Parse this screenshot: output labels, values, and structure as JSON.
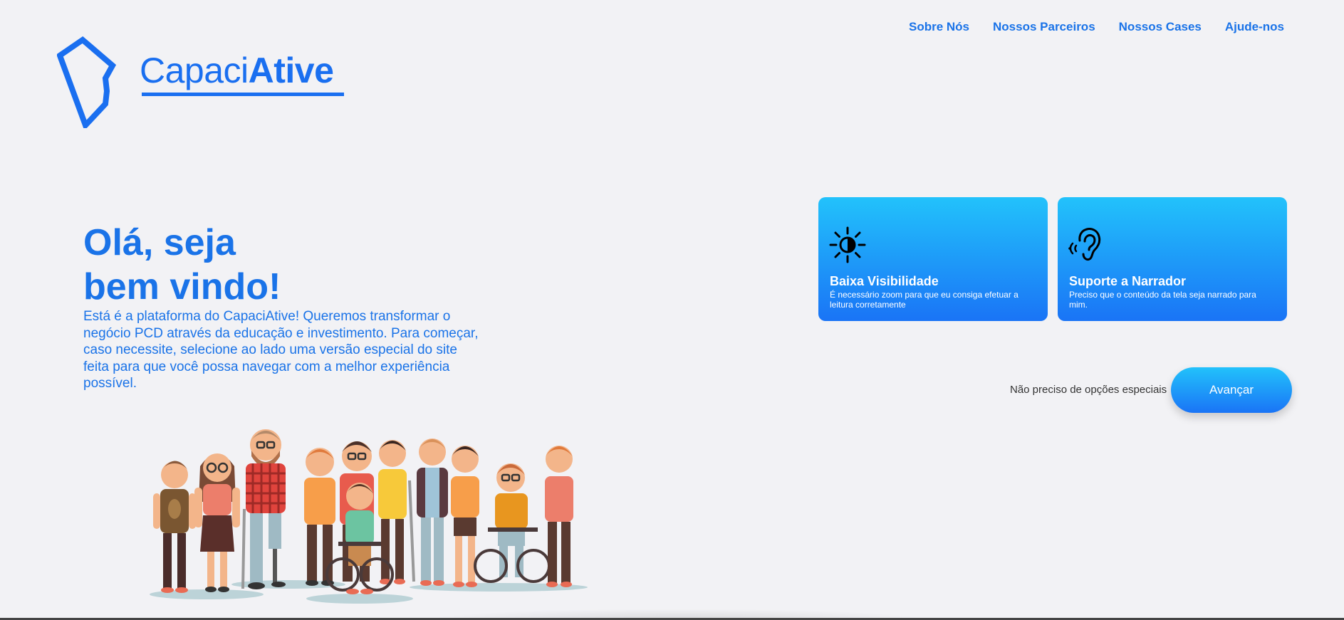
{
  "nav": {
    "items": [
      {
        "label": "Sobre Nós"
      },
      {
        "label": "Nossos Parceiros"
      },
      {
        "label": "Nossos Cases"
      },
      {
        "label": "Ajude-nos"
      }
    ]
  },
  "logo": {
    "text_light": "Capaci",
    "text_bold": "Ative",
    "icon": "kite-diamond-logo-icon"
  },
  "hero": {
    "title_line1": "Olá, seja",
    "title_line2": "bem vindo!",
    "description": "Está é a plataforma do CapaciAtive! Queremos transformar o negócio PCD através da educação e investimento. Para começar, caso necessite, selecione ao lado uma versão especial do site feita para que você possa navegar com a melhor experiência possível."
  },
  "options": [
    {
      "icon": "brightness-contrast-icon",
      "title": "Baixa Visibilidade",
      "description": "É necessário zoom para que eu consiga efetuar a leitura corretamente"
    },
    {
      "icon": "ear-sound-icon",
      "title": "Suporte a Narrador",
      "description": "Preciso que o conteúdo da tela seja narrado para mim."
    }
  ],
  "continue": {
    "skip_label": "Não preciso de opções especiais",
    "advance_label": "Avançar"
  },
  "colors": {
    "brand_blue": "#1a73e8",
    "card_gradient_top": "#22c2fb",
    "card_gradient_bottom": "#1a74f6",
    "background": "#f2f2f5"
  },
  "illustration": {
    "icon": "diverse-people-group-illustration"
  }
}
